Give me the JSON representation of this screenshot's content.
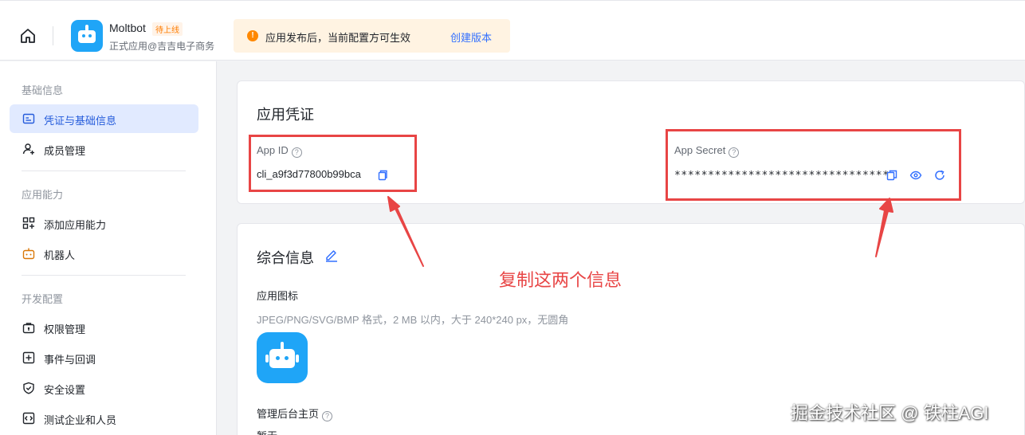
{
  "header": {
    "app_name": "Moltbot",
    "status_badge": "待上线",
    "app_subtitle": "正式应用@吉吉电子商务",
    "notice_text": "应用发布后，当前配置方可生效",
    "notice_link": "创建版本"
  },
  "sidebar": {
    "sections": [
      {
        "title": "基础信息",
        "items": [
          {
            "label": "凭证与基础信息",
            "icon": "credential-icon",
            "active": true
          },
          {
            "label": "成员管理",
            "icon": "member-icon"
          }
        ]
      },
      {
        "title": "应用能力",
        "items": [
          {
            "label": "添加应用能力",
            "icon": "grid-add-icon"
          },
          {
            "label": "机器人",
            "icon": "robot-icon"
          }
        ]
      },
      {
        "title": "开发配置",
        "items": [
          {
            "label": "权限管理",
            "icon": "permission-icon"
          },
          {
            "label": "事件与回调",
            "icon": "event-icon"
          },
          {
            "label": "安全设置",
            "icon": "shield-icon"
          },
          {
            "label": "测试企业和人员",
            "icon": "code-icon"
          }
        ]
      }
    ]
  },
  "credentials": {
    "title": "应用凭证",
    "app_id_label": "App ID",
    "app_id_value": "cli_a9f3d77800b99bca",
    "app_secret_label": "App Secret",
    "app_secret_value": "********************************"
  },
  "general": {
    "title": "综合信息",
    "icon_label": "应用图标",
    "icon_hint": "JPEG/PNG/SVG/BMP 格式，2 MB 以内，大于 240*240 px，无圆角",
    "homepage_label": "管理后台主页",
    "homepage_value": "暂无"
  },
  "annotation": {
    "text": "复制这两个信息",
    "color": "#e84545"
  },
  "watermark": "掘金技术社区 @ 铁柱AGI",
  "colors": {
    "accent": "#3370ff",
    "active_bg": "#e1eaff",
    "warning": "#ff8800",
    "logo": "#1fa5f7"
  }
}
